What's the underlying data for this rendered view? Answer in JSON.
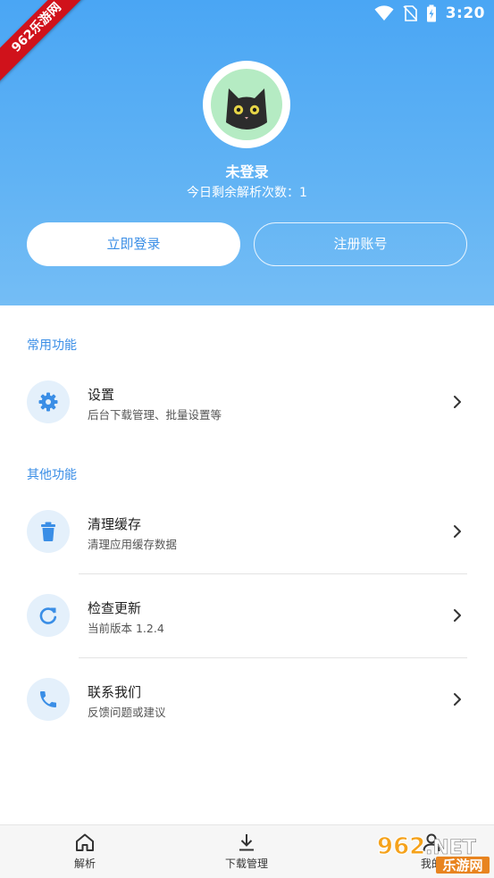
{
  "status_bar": {
    "time": "3:20",
    "icons": [
      "wifi-icon",
      "no-sim-icon",
      "battery-charging-icon"
    ]
  },
  "ribbon": {
    "text": "962乐游网"
  },
  "profile": {
    "name": "未登录",
    "remaining_label": "今日剩余解析次数：1",
    "avatar": "black-cat-avatar"
  },
  "actions": {
    "login": "立即登录",
    "register": "注册账号"
  },
  "sections": {
    "common": {
      "title": "常用功能",
      "items": [
        {
          "icon": "gear-icon",
          "title": "设置",
          "subtitle": "后台下载管理、批量设置等"
        }
      ]
    },
    "other": {
      "title": "其他功能",
      "items": [
        {
          "icon": "trash-icon",
          "title": "清理缓存",
          "subtitle": "清理应用缓存数据"
        },
        {
          "icon": "refresh-icon",
          "title": "检查更新",
          "subtitle": "当前版本 1.2.4"
        },
        {
          "icon": "phone-icon",
          "title": "联系我们",
          "subtitle": "反馈问题或建议"
        }
      ]
    }
  },
  "bottom_nav": [
    {
      "icon": "home-icon",
      "label": "解析"
    },
    {
      "icon": "download-icon",
      "label": "下载管理"
    },
    {
      "icon": "user-icon",
      "label": "我的"
    }
  ],
  "watermark": {
    "text": "962.NET",
    "sub": "乐游网"
  },
  "colors": {
    "accent": "#3a8ee6",
    "header_top": "#4aa6f4",
    "header_bottom": "#74bdf5",
    "icon_bg": "#e4f0fb",
    "avatar_bg": "#b5ebc3",
    "ribbon": "#d0121b"
  }
}
